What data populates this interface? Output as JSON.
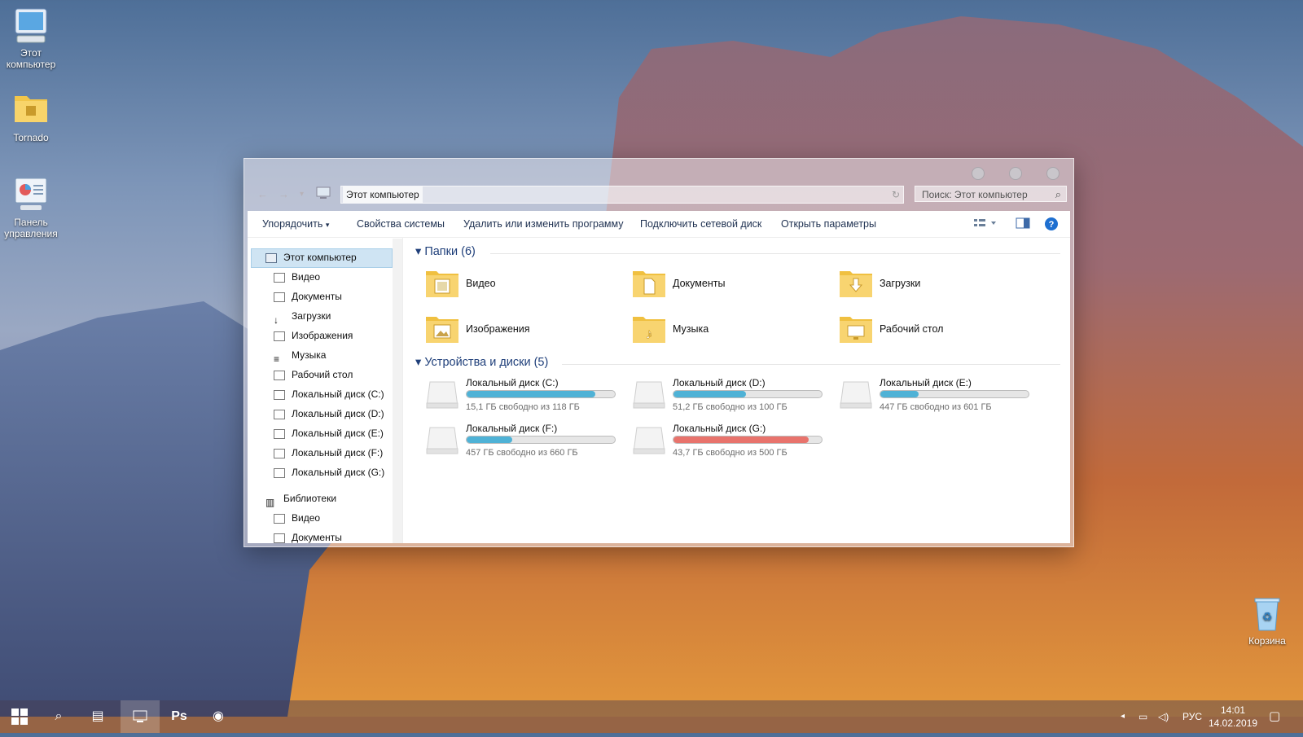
{
  "desktop": {
    "icons": [
      {
        "label": "Этот компьютер",
        "name": "this-pc"
      },
      {
        "label": "Tornado",
        "name": "tornado-folder"
      },
      {
        "label": "Панель управления",
        "name": "control-panel"
      },
      {
        "label": "Корзина",
        "name": "recycle-bin"
      }
    ]
  },
  "window": {
    "address": "Этот компьютер",
    "search_placeholder": "Поиск: Этот компьютер",
    "commands": [
      "Упорядочить",
      "Свойства системы",
      "Удалить или изменить программу",
      "Подключить сетевой диск",
      "Открыть параметры"
    ],
    "nav": {
      "selected": "Этот компьютер",
      "items": [
        "Видео",
        "Документы",
        "Загрузки",
        "Изображения",
        "Музыка",
        "Рабочий стол",
        "Локальный диск (C:)",
        "Локальный диск (D:)",
        "Локальный диск (E:)",
        "Локальный диск (F:)",
        "Локальный диск (G:)"
      ],
      "libraries": "Библиотеки",
      "lib_items": [
        "Видео",
        "Документы"
      ]
    },
    "folders_header": "Папки (6)",
    "folders": [
      {
        "label": "Видео",
        "icon": "film-icon"
      },
      {
        "label": "Документы",
        "icon": "document-icon"
      },
      {
        "label": "Загрузки",
        "icon": "download-icon"
      },
      {
        "label": "Изображения",
        "icon": "picture-icon"
      },
      {
        "label": "Музыка",
        "icon": "music-icon"
      },
      {
        "label": "Рабочий стол",
        "icon": "desktop-icon"
      }
    ],
    "drives_header": "Устройства и диски (5)",
    "drives": [
      {
        "label": "Локальный диск (C:)",
        "free": "15,1 ГБ свободно из 118 ГБ",
        "used_fraction": 0.87,
        "color": "#4fb2d6"
      },
      {
        "label": "Локальный диск (D:)",
        "free": "51,2 ГБ свободно из 100 ГБ",
        "used_fraction": 0.49,
        "color": "#4fb2d6"
      },
      {
        "label": "Локальный диск (E:)",
        "free": "447 ГБ свободно из 601 ГБ",
        "used_fraction": 0.26,
        "color": "#4fb2d6"
      },
      {
        "label": "Локальный диск (F:)",
        "free": "457 ГБ свободно из 660 ГБ",
        "used_fraction": 0.31,
        "color": "#4fb2d6"
      },
      {
        "label": "Локальный диск (G:)",
        "free": "43,7 ГБ свободно из 500 ГБ",
        "used_fraction": 0.91,
        "color": "#e8736c"
      }
    ]
  },
  "taskbar": {
    "ps_label": "Ps",
    "language": "РУС",
    "time": "14:01",
    "date": "14.02.2019"
  }
}
